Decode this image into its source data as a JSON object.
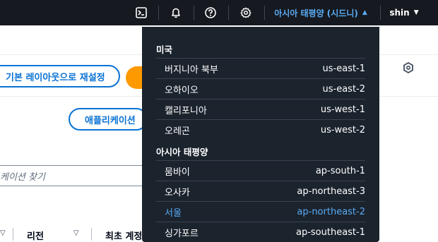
{
  "topnav": {
    "region_label": "아시아 태평양 (시드니)",
    "user_label": "shin",
    "icons": [
      "cloudshell-icon",
      "bell-icon",
      "help-icon",
      "settings-icon"
    ]
  },
  "page": {
    "reset_layout_label": "기본 레이아웃으로 재설정",
    "app_button_label": "애플리케이션",
    "search_placeholder": "케이션 찾기",
    "columns": [
      "리전",
      "최초 계정"
    ]
  },
  "region_menu": {
    "groups": [
      {
        "label": "미국",
        "regions": [
          {
            "name": "버지니아 북부",
            "code": "us-east-1",
            "selected": false
          },
          {
            "name": "오하이오",
            "code": "us-east-2",
            "selected": false
          },
          {
            "name": "캘리포니아",
            "code": "us-west-1",
            "selected": false
          },
          {
            "name": "오레곤",
            "code": "us-west-2",
            "selected": false
          }
        ]
      },
      {
        "label": "아시아 태평양",
        "regions": [
          {
            "name": "뭄바이",
            "code": "ap-south-1",
            "selected": false
          },
          {
            "name": "오사카",
            "code": "ap-northeast-3",
            "selected": false
          },
          {
            "name": "서울",
            "code": "ap-northeast-2",
            "selected": true
          },
          {
            "name": "싱가포르",
            "code": "ap-southeast-1",
            "selected": false
          }
        ]
      }
    ]
  },
  "colors": {
    "nav_bg": "#16191f",
    "dropdown_bg": "#1b232d",
    "accent": "#5aacf5",
    "link": "#0972d3",
    "orange": "#ff9900"
  }
}
